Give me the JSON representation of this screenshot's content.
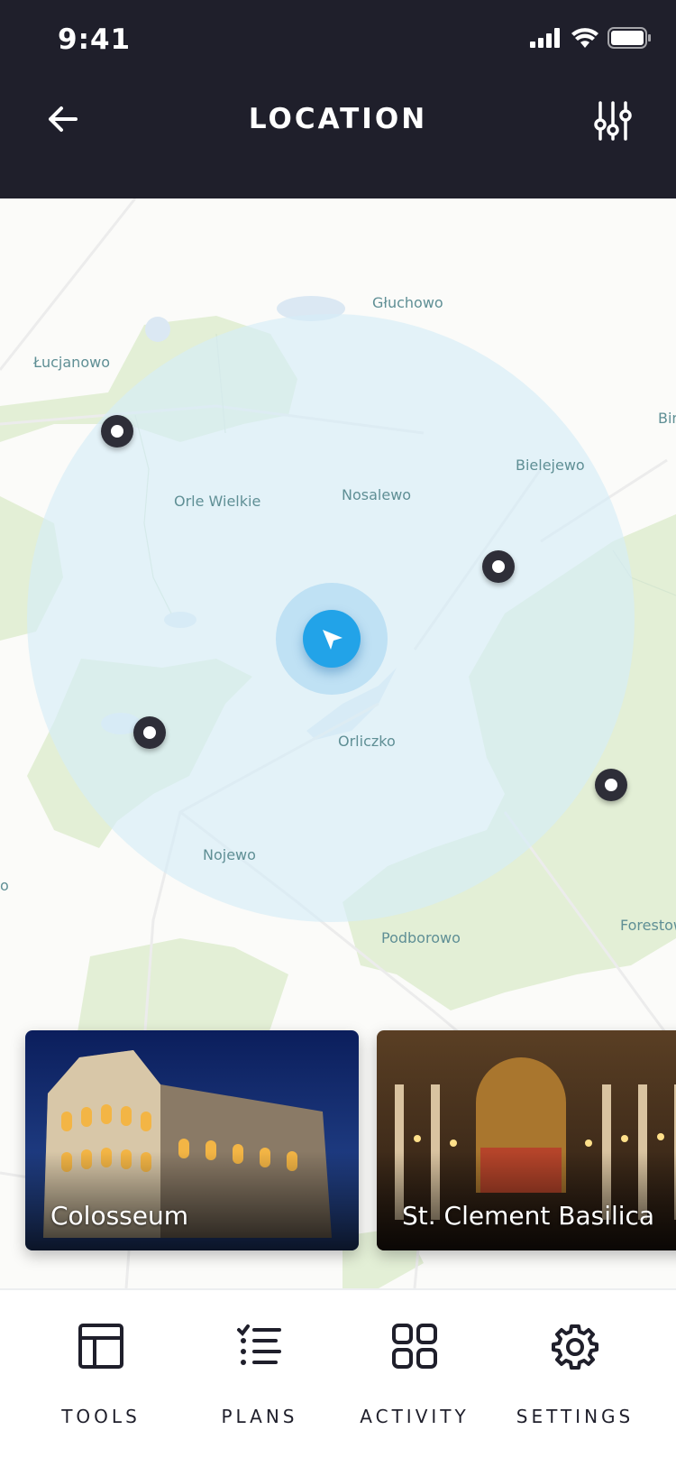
{
  "status_bar": {
    "time": "9:41"
  },
  "header": {
    "title": "LOCATION"
  },
  "map": {
    "labels": {
      "gluchowo": "Głuchowo",
      "lucjanowo": "Łucjanowo",
      "bin": "Bin",
      "bielejewo": "Bielejewo",
      "orle_wielkie": "Orle Wielkie",
      "nosalewo": "Nosalewo",
      "orliczko": "Orliczko",
      "nojewo": "Nojewo",
      "o": "o",
      "podborowo": "Podborowo",
      "forestowo": "Forestow"
    }
  },
  "cards": [
    {
      "title": "Colosseum"
    },
    {
      "title": "St. Clement Basilica"
    }
  ],
  "tabs": [
    {
      "label": "TOOLS",
      "icon": "layout-icon"
    },
    {
      "label": "PLANS",
      "icon": "checklist-icon"
    },
    {
      "label": "ACTIVITY",
      "icon": "grid-icon"
    },
    {
      "label": "SETTINGS",
      "icon": "gear-icon"
    }
  ],
  "colors": {
    "header": "#1f1f2b",
    "accent": "#22a3e8",
    "pin": "#2e2e38"
  }
}
